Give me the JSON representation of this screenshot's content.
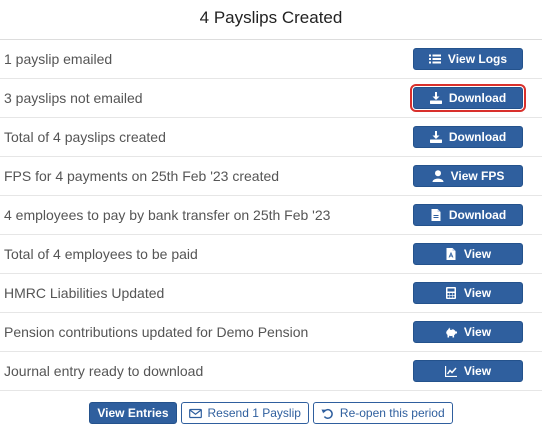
{
  "header": {
    "title": "4 Payslips Created"
  },
  "rows": [
    {
      "label": "1 payslip emailed",
      "button": {
        "label": "View Logs",
        "icon": "list-icon"
      }
    },
    {
      "label": "3 payslips not emailed",
      "button": {
        "label": "Download",
        "icon": "download-icon"
      }
    },
    {
      "label": "Total of 4 payslips created",
      "button": {
        "label": "Download",
        "icon": "download-icon"
      }
    },
    {
      "label": "FPS for 4 payments on 25th Feb '23 created",
      "button": {
        "label": "View FPS",
        "icon": "user-icon"
      }
    },
    {
      "label": "4 employees to pay by bank transfer on 25th Feb '23",
      "button": {
        "label": "Download",
        "icon": "file-icon"
      }
    },
    {
      "label": "Total of 4 employees to be paid",
      "button": {
        "label": "View",
        "icon": "pdf-file-icon"
      }
    },
    {
      "label": "HMRC Liabilities Updated",
      "button": {
        "label": "View",
        "icon": "calculator-icon"
      }
    },
    {
      "label": "Pension contributions updated for Demo Pension",
      "button": {
        "label": "View",
        "icon": "piggy-bank-icon"
      }
    },
    {
      "label": "Journal entry ready to download",
      "button": {
        "label": "View",
        "icon": "chart-icon"
      }
    }
  ],
  "footer": {
    "view_entries": "View Entries",
    "resend": "Resend 1 Payslip",
    "reopen": "Re-open this period"
  },
  "colors": {
    "button_bg": "#2f5f9e",
    "highlight_border": "#d9302c"
  }
}
